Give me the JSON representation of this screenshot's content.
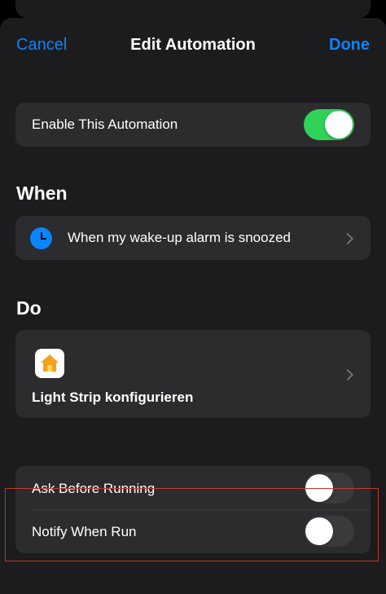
{
  "nav": {
    "cancel": "Cancel",
    "title": "Edit Automation",
    "done": "Done"
  },
  "enable": {
    "label": "Enable This Automation",
    "state": "on"
  },
  "when": {
    "title": "When",
    "trigger_text": "When my wake-up alarm is snoozed",
    "icon": "clock-icon"
  },
  "do": {
    "title": "Do",
    "action_text": "Light Strip konfigurieren",
    "icon": "home-icon"
  },
  "options": {
    "ask_before_running": {
      "label": "Ask Before Running",
      "state": "off"
    },
    "notify_when_run": {
      "label": "Notify When Run",
      "state": "off"
    }
  },
  "colors": {
    "accent": "#0a84ff",
    "toggle_on": "#30d158",
    "card": "#2c2c2e",
    "sheet": "#1c1c1e",
    "highlight": "#c0392b"
  }
}
